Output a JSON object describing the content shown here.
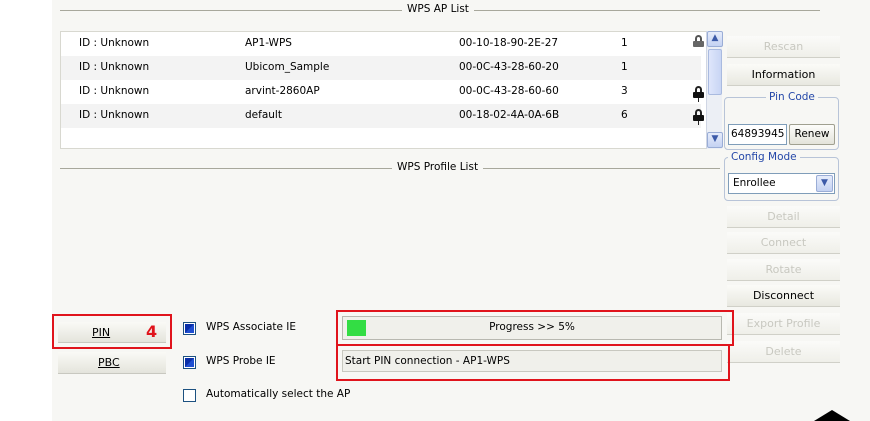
{
  "ap_list": {
    "title": "WPS AP List",
    "rows": [
      {
        "id": "ID : Unknown",
        "ssid": "AP1-WPS",
        "bssid": "00-10-18-90-2E-27",
        "channel": "1",
        "lock": "lock-open"
      },
      {
        "id": "ID : Unknown",
        "ssid": "Ubicom_Sample",
        "bssid": "00-0C-43-28-60-20",
        "channel": "1",
        "lock": ""
      },
      {
        "id": "ID : Unknown",
        "ssid": "arvint-2860AP",
        "bssid": "00-0C-43-28-60-60",
        "channel": "3",
        "lock": "lock-closed"
      },
      {
        "id": "ID : Unknown",
        "ssid": "default",
        "bssid": "00-18-02-4A-0A-6B",
        "channel": "6",
        "lock": "lock-closed"
      }
    ]
  },
  "profile_list": {
    "title": "WPS Profile List"
  },
  "right_panel": {
    "rescan": "Rescan",
    "information": "Information",
    "pin_code_legend": "Pin Code",
    "pin_code_value": "64893945",
    "renew": "Renew",
    "config_mode_legend": "Config Mode",
    "config_mode_value": "Enrollee",
    "detail": "Detail",
    "connect": "Connect",
    "rotate": "Rotate",
    "disconnect": "Disconnect",
    "export_profile": "Export Profile",
    "delete": "Delete"
  },
  "bottom": {
    "pin_button": "PIN",
    "pin_annotation": "4",
    "pbc_button": "PBC",
    "wps_associate_ie": "WPS Associate IE",
    "wps_probe_ie": "WPS Probe IE",
    "auto_select": "Automatically select the AP",
    "progress_text": "Progress >> 5%",
    "progress_value": 0.05,
    "status_text": "Start PIN connection - AP1-WPS"
  },
  "colors": {
    "highlight_red": "#e0141c",
    "progress_green": "#33dd44",
    "legend_blue": "#2447a8"
  }
}
